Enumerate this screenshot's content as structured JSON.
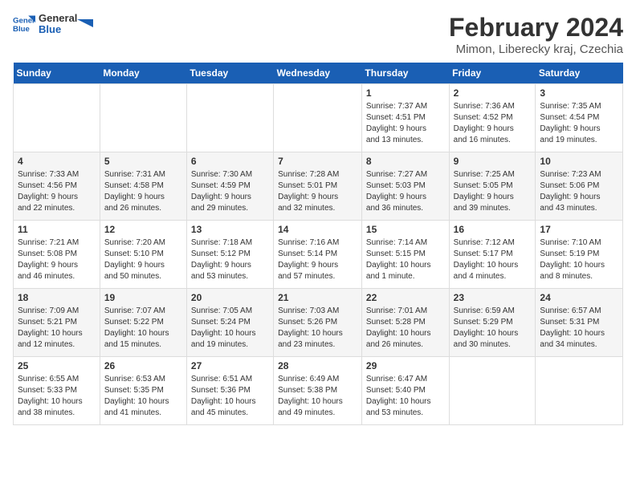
{
  "header": {
    "logo_line1": "General",
    "logo_line2": "Blue",
    "title": "February 2024",
    "subtitle": "Mimon, Liberecky kraj, Czechia"
  },
  "weekdays": [
    "Sunday",
    "Monday",
    "Tuesday",
    "Wednesday",
    "Thursday",
    "Friday",
    "Saturday"
  ],
  "weeks": [
    [
      {
        "day": "",
        "info": ""
      },
      {
        "day": "",
        "info": ""
      },
      {
        "day": "",
        "info": ""
      },
      {
        "day": "",
        "info": ""
      },
      {
        "day": "1",
        "info": "Sunrise: 7:37 AM\nSunset: 4:51 PM\nDaylight: 9 hours\nand 13 minutes."
      },
      {
        "day": "2",
        "info": "Sunrise: 7:36 AM\nSunset: 4:52 PM\nDaylight: 9 hours\nand 16 minutes."
      },
      {
        "day": "3",
        "info": "Sunrise: 7:35 AM\nSunset: 4:54 PM\nDaylight: 9 hours\nand 19 minutes."
      }
    ],
    [
      {
        "day": "4",
        "info": "Sunrise: 7:33 AM\nSunset: 4:56 PM\nDaylight: 9 hours\nand 22 minutes."
      },
      {
        "day": "5",
        "info": "Sunrise: 7:31 AM\nSunset: 4:58 PM\nDaylight: 9 hours\nand 26 minutes."
      },
      {
        "day": "6",
        "info": "Sunrise: 7:30 AM\nSunset: 4:59 PM\nDaylight: 9 hours\nand 29 minutes."
      },
      {
        "day": "7",
        "info": "Sunrise: 7:28 AM\nSunset: 5:01 PM\nDaylight: 9 hours\nand 32 minutes."
      },
      {
        "day": "8",
        "info": "Sunrise: 7:27 AM\nSunset: 5:03 PM\nDaylight: 9 hours\nand 36 minutes."
      },
      {
        "day": "9",
        "info": "Sunrise: 7:25 AM\nSunset: 5:05 PM\nDaylight: 9 hours\nand 39 minutes."
      },
      {
        "day": "10",
        "info": "Sunrise: 7:23 AM\nSunset: 5:06 PM\nDaylight: 9 hours\nand 43 minutes."
      }
    ],
    [
      {
        "day": "11",
        "info": "Sunrise: 7:21 AM\nSunset: 5:08 PM\nDaylight: 9 hours\nand 46 minutes."
      },
      {
        "day": "12",
        "info": "Sunrise: 7:20 AM\nSunset: 5:10 PM\nDaylight: 9 hours\nand 50 minutes."
      },
      {
        "day": "13",
        "info": "Sunrise: 7:18 AM\nSunset: 5:12 PM\nDaylight: 9 hours\nand 53 minutes."
      },
      {
        "day": "14",
        "info": "Sunrise: 7:16 AM\nSunset: 5:14 PM\nDaylight: 9 hours\nand 57 minutes."
      },
      {
        "day": "15",
        "info": "Sunrise: 7:14 AM\nSunset: 5:15 PM\nDaylight: 10 hours\nand 1 minute."
      },
      {
        "day": "16",
        "info": "Sunrise: 7:12 AM\nSunset: 5:17 PM\nDaylight: 10 hours\nand 4 minutes."
      },
      {
        "day": "17",
        "info": "Sunrise: 7:10 AM\nSunset: 5:19 PM\nDaylight: 10 hours\nand 8 minutes."
      }
    ],
    [
      {
        "day": "18",
        "info": "Sunrise: 7:09 AM\nSunset: 5:21 PM\nDaylight: 10 hours\nand 12 minutes."
      },
      {
        "day": "19",
        "info": "Sunrise: 7:07 AM\nSunset: 5:22 PM\nDaylight: 10 hours\nand 15 minutes."
      },
      {
        "day": "20",
        "info": "Sunrise: 7:05 AM\nSunset: 5:24 PM\nDaylight: 10 hours\nand 19 minutes."
      },
      {
        "day": "21",
        "info": "Sunrise: 7:03 AM\nSunset: 5:26 PM\nDaylight: 10 hours\nand 23 minutes."
      },
      {
        "day": "22",
        "info": "Sunrise: 7:01 AM\nSunset: 5:28 PM\nDaylight: 10 hours\nand 26 minutes."
      },
      {
        "day": "23",
        "info": "Sunrise: 6:59 AM\nSunset: 5:29 PM\nDaylight: 10 hours\nand 30 minutes."
      },
      {
        "day": "24",
        "info": "Sunrise: 6:57 AM\nSunset: 5:31 PM\nDaylight: 10 hours\nand 34 minutes."
      }
    ],
    [
      {
        "day": "25",
        "info": "Sunrise: 6:55 AM\nSunset: 5:33 PM\nDaylight: 10 hours\nand 38 minutes."
      },
      {
        "day": "26",
        "info": "Sunrise: 6:53 AM\nSunset: 5:35 PM\nDaylight: 10 hours\nand 41 minutes."
      },
      {
        "day": "27",
        "info": "Sunrise: 6:51 AM\nSunset: 5:36 PM\nDaylight: 10 hours\nand 45 minutes."
      },
      {
        "day": "28",
        "info": "Sunrise: 6:49 AM\nSunset: 5:38 PM\nDaylight: 10 hours\nand 49 minutes."
      },
      {
        "day": "29",
        "info": "Sunrise: 6:47 AM\nSunset: 5:40 PM\nDaylight: 10 hours\nand 53 minutes."
      },
      {
        "day": "",
        "info": ""
      },
      {
        "day": "",
        "info": ""
      }
    ]
  ]
}
